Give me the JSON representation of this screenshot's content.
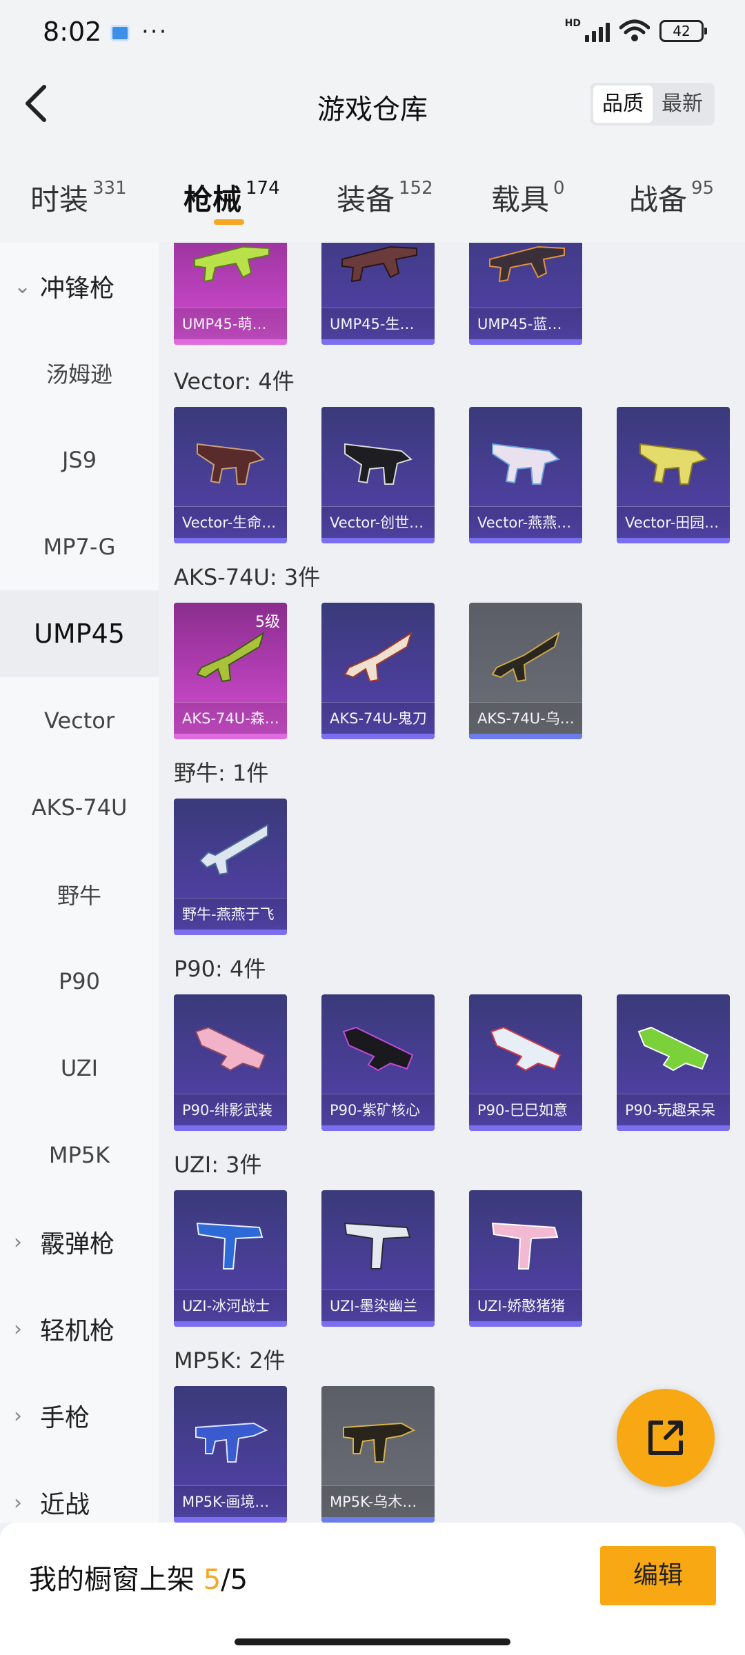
{
  "status": {
    "time": "8:02",
    "dots": "···",
    "hd": "HD",
    "battery": "42"
  },
  "header": {
    "title": "游戏仓库",
    "sort_quality": "品质",
    "sort_latest": "最新"
  },
  "tabs": [
    {
      "label": "时装",
      "count": "331"
    },
    {
      "label": "枪械",
      "count": "174"
    },
    {
      "label": "装备",
      "count": "152"
    },
    {
      "label": "载具",
      "count": "0"
    },
    {
      "label": "战备",
      "count": "95"
    }
  ],
  "sidebar": [
    {
      "label": "冲锋枪"
    },
    {
      "label": "汤姆逊"
    },
    {
      "label": "JS9"
    },
    {
      "label": "MP7-G"
    },
    {
      "label": "UMP45"
    },
    {
      "label": "Vector"
    },
    {
      "label": "AKS-74U"
    },
    {
      "label": "野牛"
    },
    {
      "label": "P90"
    },
    {
      "label": "UZI"
    },
    {
      "label": "MP5K"
    },
    {
      "label": "霰弹枪"
    },
    {
      "label": "轻机枪"
    },
    {
      "label": "手枪"
    },
    {
      "label": "近战"
    }
  ],
  "sections": {
    "ump45": {
      "items": [
        "UMP45-萌…",
        "UMP45-生…",
        "UMP45-蓝…"
      ]
    },
    "vector": {
      "title": "Vector: 4件",
      "items": [
        "Vector-生命…",
        "Vector-创世…",
        "Vector-燕燕…",
        "Vector-田园…"
      ]
    },
    "aks": {
      "title": "AKS-74U: 3件",
      "items": [
        "AKS-74U-森…",
        "AKS-74U-鬼刀",
        "AKS-74U-乌…"
      ],
      "level": "5级"
    },
    "bison": {
      "title": "野牛: 1件",
      "items": [
        "野牛-燕燕于飞"
      ]
    },
    "p90": {
      "title": "P90: 4件",
      "items": [
        "P90-绯影武装",
        "P90-紫矿核心",
        "P90-巳巳如意",
        "P90-玩趣呆呆"
      ]
    },
    "uzi": {
      "title": "UZI: 3件",
      "items": [
        "UZI-冰河战士",
        "UZI-墨染幽兰",
        "UZI-娇憨猪猪"
      ]
    },
    "mp5k": {
      "title": "MP5K: 2件",
      "items": [
        "MP5K-画境…",
        "MP5K-乌木…"
      ]
    }
  },
  "bottom": {
    "label": "我的橱窗上架",
    "current": "5",
    "total": "/5",
    "edit": "编辑"
  },
  "colors": {
    "accent": "#f7a812",
    "purple_card": "#4d3f9e",
    "pink_card": "#c044c0",
    "gray_card": "#676a72"
  },
  "icons": {
    "back": "chevron-left-icon",
    "share": "share-external-icon"
  }
}
